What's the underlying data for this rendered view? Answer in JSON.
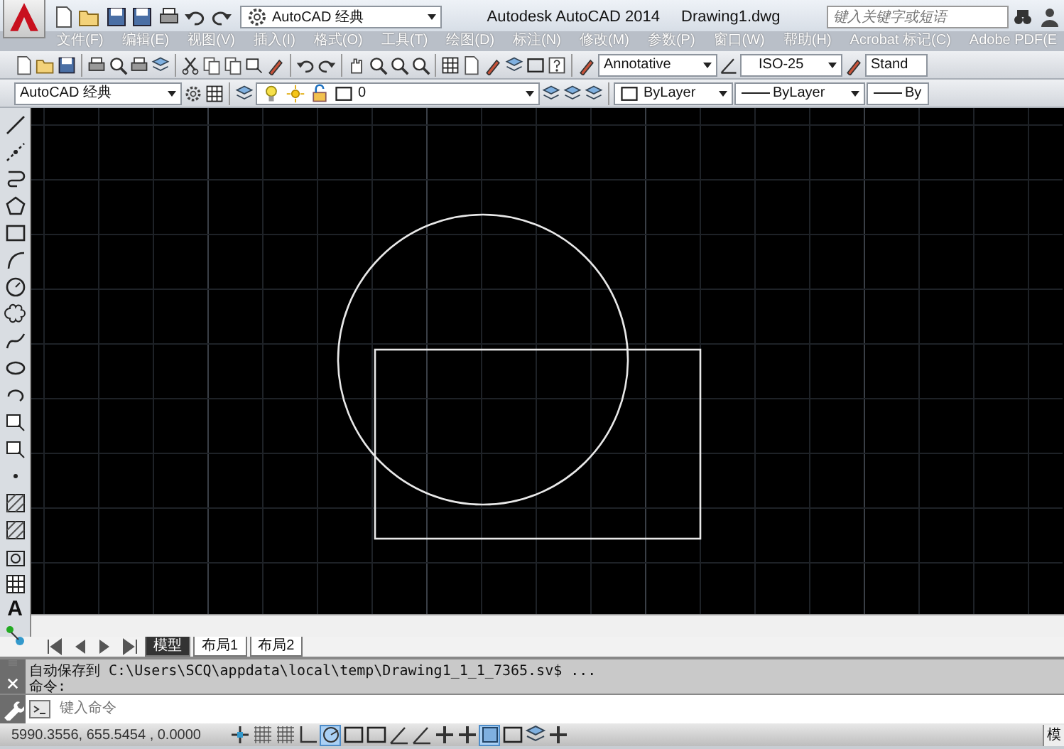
{
  "title_bar": {
    "workspace": "AutoCAD 经典",
    "app_name": "Autodesk AutoCAD 2014",
    "document": "Drawing1.dwg",
    "search": {
      "placeholder": "键入关键字或短语"
    }
  },
  "menu": [
    "文件(F)",
    "编辑(E)",
    "视图(V)",
    "插入(I)",
    "格式(O)",
    "工具(T)",
    "绘图(D)",
    "标注(N)",
    "修改(M)",
    "参数(P)",
    "窗口(W)",
    "帮助(H)",
    "Acrobat 标记(C)",
    "Adobe PDF(E"
  ],
  "styles_toolbar": {
    "text_style": "Annotative",
    "dim_style": "ISO-25",
    "table_style": "Stand"
  },
  "layers_toolbar": {
    "workspace": "AutoCAD 经典",
    "layer": "0",
    "color_setting": "ByLayer",
    "linetype": "ByLayer",
    "lineweight": "By"
  },
  "draw_toolbar": {
    "text_tool": "A"
  },
  "layout_tabs": [
    {
      "label": "模型",
      "selected": true
    },
    {
      "label": "布局1",
      "selected": false
    },
    {
      "label": "布局2",
      "selected": false
    }
  ],
  "command_history": [
    "自动保存到 C:\\Users\\SCQ\\appdata\\local\\temp\\Drawing1_1_1_7365.sv$ ...",
    "命令:"
  ],
  "command_line": {
    "placeholder": "键入命令"
  },
  "status_bar": {
    "coordinates": "5990.3556, 655.5454 , 0.0000",
    "toggles": [
      {
        "on": false
      },
      {
        "on": false
      },
      {
        "on": false
      },
      {
        "on": false
      },
      {
        "on": true
      },
      {
        "on": false
      },
      {
        "on": false
      },
      {
        "on": false
      },
      {
        "on": false
      },
      {
        "on": false
      },
      {
        "on": false
      },
      {
        "on": true
      },
      {
        "on": false
      },
      {
        "on": false
      },
      {
        "on": false
      }
    ],
    "model_label": "模"
  }
}
